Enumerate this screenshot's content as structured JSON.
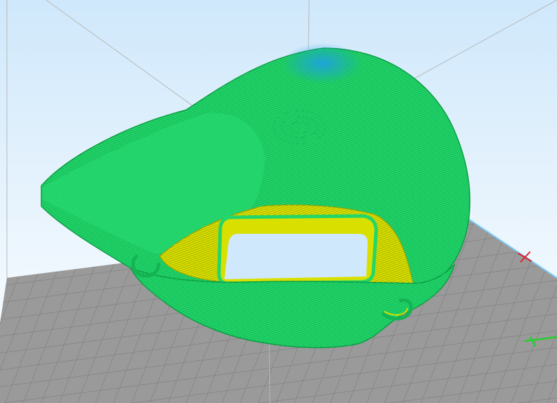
{
  "viewport": {
    "background_top": "#cfe8fb",
    "background_bottom": "#ffffff",
    "bed_color": "#9a9a9a",
    "bed_grid_color": "#7e7e7e",
    "build_volume_line_color": "#b8b8b8"
  },
  "model": {
    "shell_color": "#22d66a",
    "shell_dark": "#14b454",
    "top_highlight": "#1ea0e6",
    "infill_color": "#d9e000",
    "infill_dark": "#a9b000",
    "opening_color": "#cfe8fb"
  },
  "axes": {
    "x_color": "#e0202a",
    "y_color": "#23d02a"
  },
  "icons": {
    "x_axis": "x-axis-marker-icon",
    "y_axis": "y-axis-marker-icon"
  }
}
